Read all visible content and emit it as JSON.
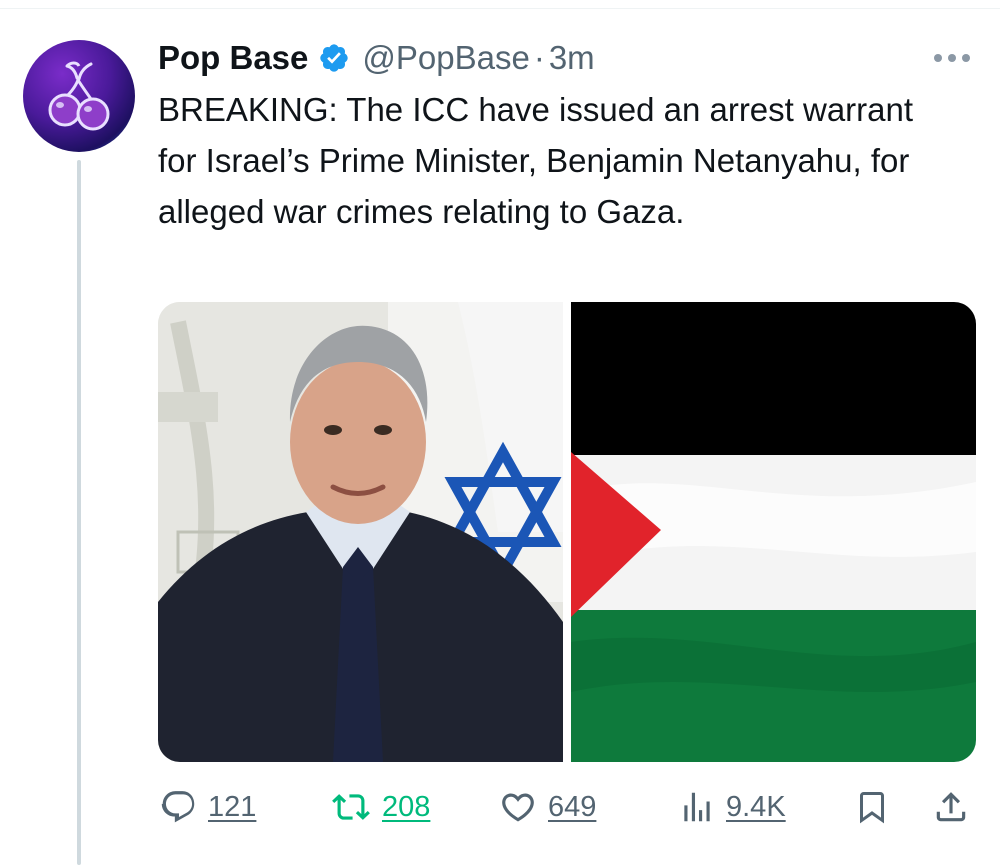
{
  "tweet": {
    "author": {
      "display_name": "Pop Base",
      "handle": "@PopBase",
      "separator": "·",
      "time": "3m",
      "avatar_icon": "cherry-icon",
      "verified_icon": "verified-badge-icon"
    },
    "text": "BREAKING: The ICC have issued an arrest warrant for Israel’s Prime Minister, Benjamin Netanyahu, for alleged war crimes relating to Gaza.",
    "media": [
      {
        "kind": "photo",
        "subject": "portrait"
      },
      {
        "kind": "photo",
        "subject": "palestinian-flag"
      }
    ],
    "actions": {
      "replies": "121",
      "reposts": "208",
      "likes": "649",
      "views": "9.4K",
      "icons": [
        "reply-icon",
        "repost-icon",
        "like-icon",
        "views-icon",
        "bookmark-icon",
        "share-icon"
      ]
    }
  },
  "colors": {
    "text": "#0f1419",
    "secondary": "#536471",
    "verified": "#1d9bf0",
    "repost": "#00ba7c",
    "thread_line": "#cfd9de"
  }
}
